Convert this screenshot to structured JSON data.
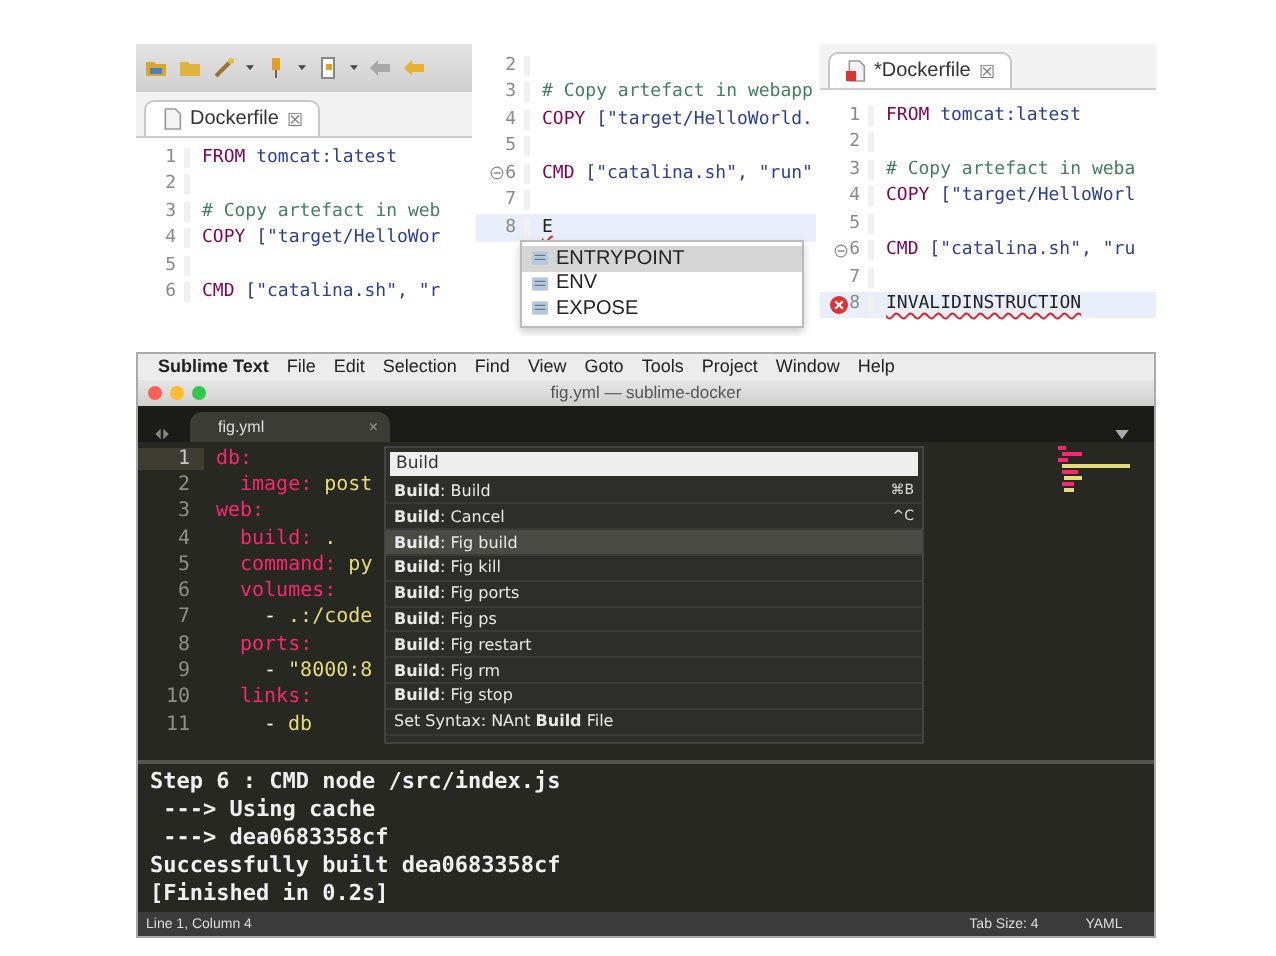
{
  "eclipse_panels": [
    {
      "toolbar": true,
      "tab": {
        "label": "Dockerfile",
        "close": "☒",
        "error": false
      },
      "lines": [
        {
          "number": "1",
          "keyword": "FROM",
          "rest": "tomcat:latest",
          "current": false
        },
        {
          "number": "2",
          "current": false
        },
        {
          "number": "3",
          "comment": "# Copy artefact in web",
          "current": false
        },
        {
          "number": "4",
          "keyword": "COPY",
          "rest": "[\"target/HelloWor",
          "current": false
        },
        {
          "number": "5",
          "current": false
        },
        {
          "number": "6",
          "keyword": "CMD",
          "rest": "[\"catalina.sh\", \"r",
          "current": false
        }
      ]
    },
    {
      "toolbar": false,
      "lines": [
        {
          "number": "2",
          "current": false
        },
        {
          "number": "3",
          "comment": "# Copy artefact in webapp",
          "current": false
        },
        {
          "number": "4",
          "keyword": "COPY",
          "rest": "[\"target/HelloWorld.",
          "current": false
        },
        {
          "number": "5",
          "current": false
        },
        {
          "number": "6",
          "keyword": "CMD",
          "rest": "[\"catalina.sh\", \"run\"",
          "current": false,
          "kind": "fold"
        },
        {
          "number": "7",
          "current": false
        },
        {
          "number": "8",
          "plain": "E",
          "squiggle": true,
          "current": true
        }
      ],
      "completions": [
        {
          "label": "ENTRYPOINT",
          "selected": true
        },
        {
          "label": "ENV",
          "selected": false
        },
        {
          "label": "EXPOSE",
          "selected": false
        }
      ]
    },
    {
      "toolbar": false,
      "tab": {
        "label": "*Dockerfile",
        "close": "☒",
        "error": true
      },
      "lines": [
        {
          "number": "1",
          "keyword": "FROM",
          "rest": "tomcat:latest",
          "current": false
        },
        {
          "number": "2",
          "current": false
        },
        {
          "number": "3",
          "comment": "# Copy artefact in weba",
          "current": false
        },
        {
          "number": "4",
          "keyword": "COPY",
          "rest": "[\"target/HelloWorl",
          "current": false
        },
        {
          "number": "5",
          "current": false
        },
        {
          "number": "6",
          "keyword": "CMD",
          "rest": "[\"catalina.sh\", \"ru",
          "current": false,
          "kind": "fold"
        },
        {
          "number": "7",
          "current": false
        },
        {
          "number": "8",
          "plain": "INVALIDINSTRUCTION",
          "squiggle": true,
          "current": true,
          "kind": "error"
        }
      ]
    }
  ],
  "sublime": {
    "menu": [
      {
        "label": "Sublime Text",
        "app": true
      },
      {
        "label": "File",
        "app": false
      },
      {
        "label": "Edit",
        "app": false
      },
      {
        "label": "Selection",
        "app": false
      },
      {
        "label": "Find",
        "app": false
      },
      {
        "label": "View",
        "app": false
      },
      {
        "label": "Goto",
        "app": false
      },
      {
        "label": "Tools",
        "app": false
      },
      {
        "label": "Project",
        "app": false
      },
      {
        "label": "Window",
        "app": false
      },
      {
        "label": "Help",
        "app": false
      }
    ],
    "title": "fig.yml — sublime-docker",
    "tab": {
      "label": "fig.yml",
      "close": "×"
    },
    "lines": [
      {
        "number": "1",
        "key": "db:",
        "current": true,
        "children": [
          {
            "number": "2",
            "key": "image:",
            "value": "post",
            "current": false
          }
        ]
      },
      {
        "number": "3",
        "key": "web:",
        "current": false,
        "children": [
          {
            "number": "4",
            "key": "build:",
            "value": ".",
            "current": false
          },
          {
            "number": "5",
            "key": "command:",
            "value": "py",
            "current": false
          },
          {
            "number": "6",
            "key": "volumes:",
            "current": false,
            "children": [
              {
                "number": "7",
                "dash": "-",
                "value": ".:/code",
                "current": false
              }
            ]
          },
          {
            "number": "8",
            "key": "ports:",
            "current": false,
            "children": [
              {
                "number": "9",
                "dash": "-",
                "value": "\"8000:8",
                "current": false
              }
            ]
          },
          {
            "number": "10",
            "key": "links:",
            "current": false,
            "children": [
              {
                "number": "11",
                "dash": "-",
                "value": "db",
                "current": false
              }
            ]
          }
        ]
      }
    ],
    "palette": {
      "query": "Build",
      "items": [
        {
          "text": "**Build**: Build",
          "shortcut": "⌘B",
          "selected": false
        },
        {
          "text": "**Build**: Cancel",
          "shortcut": "^C",
          "selected": false
        },
        {
          "text": "**Build**: Fig build",
          "selected": true
        },
        {
          "text": "**Build**: Fig kill",
          "selected": false
        },
        {
          "text": "**Build**: Fig ports",
          "selected": false
        },
        {
          "text": "**Build**: Fig ps",
          "selected": false
        },
        {
          "text": "**Build**: Fig restart",
          "selected": false
        },
        {
          "text": "**Build**: Fig rm",
          "selected": false
        },
        {
          "text": "**Build**: Fig stop",
          "selected": false
        },
        {
          "text": "Set Syntax: NAnt **Build** File",
          "selected": false
        }
      ]
    },
    "output": [
      "Step 6 : CMD node /src/index.js",
      " ---> Using cache",
      " ---> dea0683358cf",
      "Successfully built dea0683358cf",
      "[Finished in 0.2s]"
    ],
    "status": {
      "position": "Line 1, Column 4",
      "tab_size": "Tab Size: 4",
      "syntax": "YAML"
    }
  }
}
